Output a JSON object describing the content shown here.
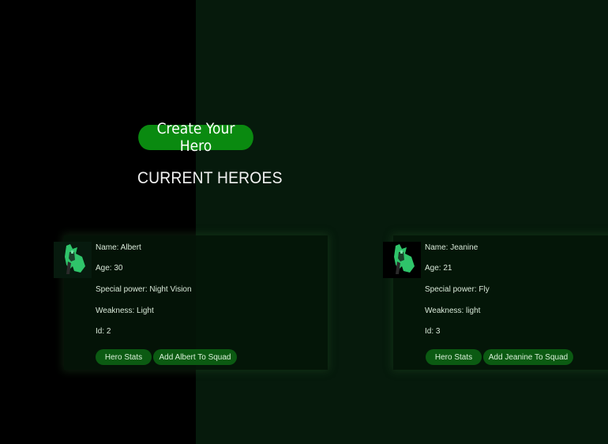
{
  "create_button": {
    "label": "Create Your Hero"
  },
  "section": {
    "title": "CURRENT HEROES"
  },
  "heroes": [
    {
      "name": "Name: Albert",
      "age": "Age: 30",
      "power": "Special power: Night Vision",
      "weakness": "Weakness: Light",
      "id": "Id: 2",
      "stats_label": "Hero Stats",
      "squad_label": "Add Albert To Squad",
      "avatar_icon": "hero-figure-icon"
    },
    {
      "name": "Name: Jeanine",
      "age": "Age: 21",
      "power": "Special power: Fly",
      "weakness": "Weakness: light",
      "id": "Id: 3",
      "stats_label": "Hero Stats",
      "squad_label": "Add Jeanine To Squad",
      "avatar_icon": "hero-figure-icon"
    }
  ],
  "colors": {
    "background": "#061a0c",
    "left_panel": "#000000",
    "accent_green": "#0a8a10",
    "button_green": "#0b5a12"
  }
}
